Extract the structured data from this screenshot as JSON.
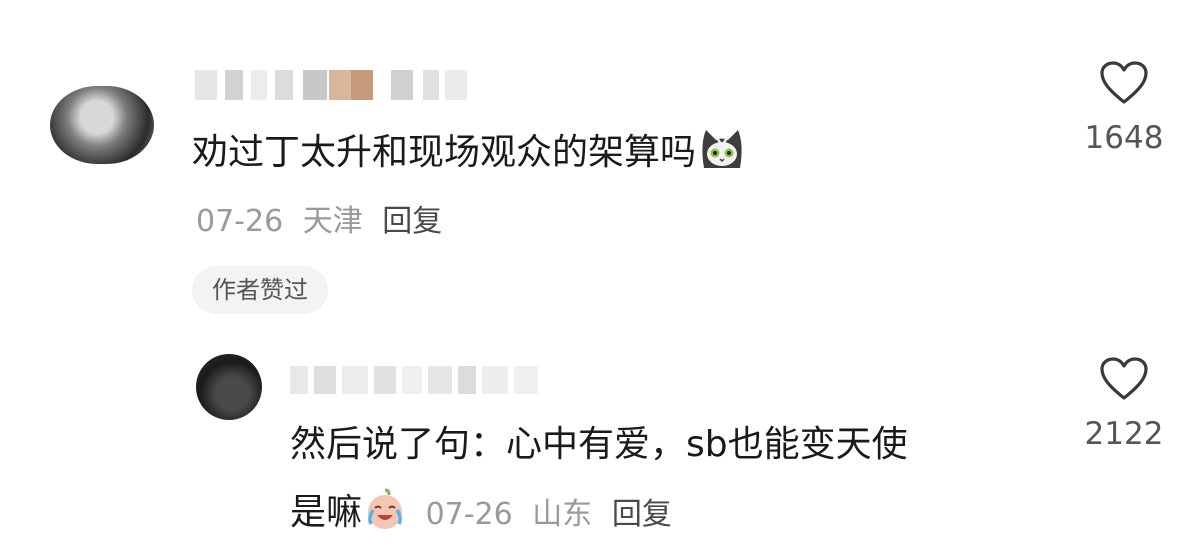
{
  "comments": [
    {
      "text": "劝过丁太升和现场观众的架算吗",
      "emoji": "cat-emoji",
      "date": "07-26",
      "location": "天津",
      "reply_label": "回复",
      "author_badge": "作者赞过",
      "likes": "1648"
    },
    {
      "text_line1": "然后说了句：心中有爱，sb也能变天使",
      "text_line2": "是嘛",
      "emoji": "crying-laugh-emoji",
      "date": "07-26",
      "location": "山东",
      "reply_label": "回复",
      "likes": "2122"
    }
  ],
  "icons": {
    "like": "heart-outline-icon"
  },
  "colors": {
    "text": "#1a1a1a",
    "meta": "#9a9a9a",
    "badge_bg": "#f3f3f3"
  }
}
